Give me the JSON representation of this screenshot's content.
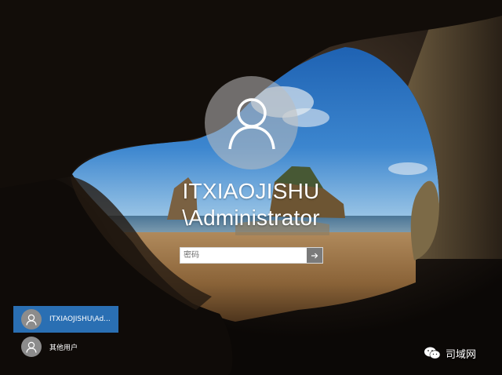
{
  "lock_screen": {
    "current_user": {
      "name_line1": "ITXIAOJISHU",
      "name_line2": "\\Administrator",
      "avatar_icon": "user-silhouette-icon"
    },
    "password": {
      "placeholder": "密码",
      "value": "",
      "submit_icon": "arrow-right-icon"
    }
  },
  "user_list": [
    {
      "label": "ITXIAOJISHU\\Ad...",
      "selected": true,
      "icon": "user-silhouette-icon"
    },
    {
      "label": "其他用户",
      "selected": false,
      "icon": "user-silhouette-icon"
    }
  ],
  "watermark": {
    "text": "司域网",
    "icon": "wechat-icon"
  },
  "colors": {
    "selected_tile": "#2a6fb3",
    "input_submit": "#7a7a7a",
    "avatar_circle": "#bebebe"
  }
}
